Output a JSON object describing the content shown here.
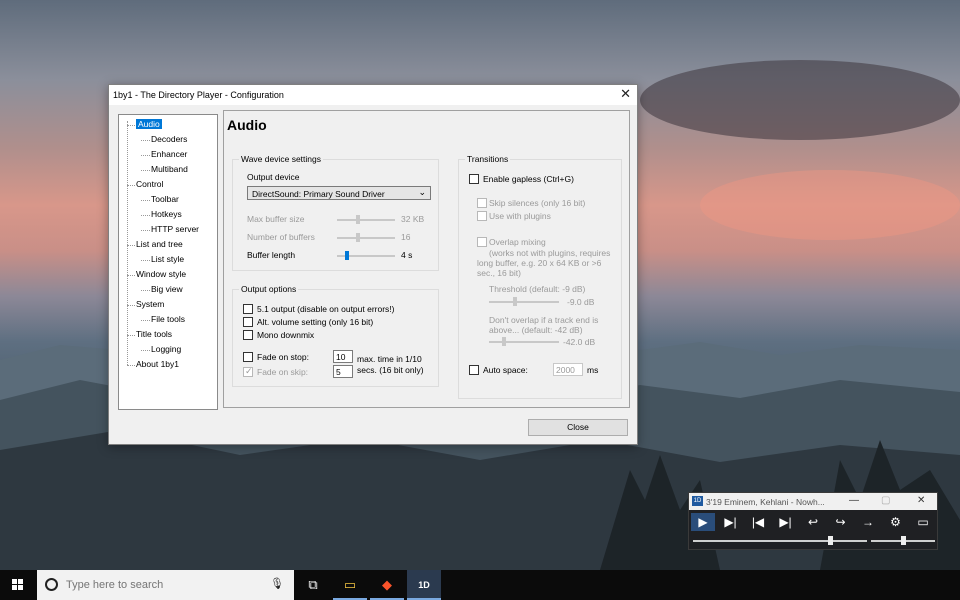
{
  "window": {
    "title": "1by1 - The Directory Player - Configuration",
    "close_glyph": "✕"
  },
  "tree": [
    {
      "label": "Audio",
      "indent": 0,
      "selected": true
    },
    {
      "label": "Decoders",
      "indent": 1
    },
    {
      "label": "Enhancer",
      "indent": 1
    },
    {
      "label": "Multiband",
      "indent": 1
    },
    {
      "label": "Control",
      "indent": 0
    },
    {
      "label": "Toolbar",
      "indent": 1
    },
    {
      "label": "Hotkeys",
      "indent": 1
    },
    {
      "label": "HTTP server",
      "indent": 1
    },
    {
      "label": "List and tree",
      "indent": 0
    },
    {
      "label": "List style",
      "indent": 1
    },
    {
      "label": "Window style",
      "indent": 0
    },
    {
      "label": "Big view",
      "indent": 1
    },
    {
      "label": "System",
      "indent": 0
    },
    {
      "label": "File tools",
      "indent": 1
    },
    {
      "label": "Title tools",
      "indent": 0
    },
    {
      "label": "Logging",
      "indent": 1
    },
    {
      "label": "About 1by1",
      "indent": 0
    }
  ],
  "panel": {
    "title": "Audio",
    "wave": {
      "group": "Wave device settings",
      "output_device_label": "Output device",
      "output_device_value": "DirectSound: Primary Sound Driver",
      "max_buffer_label": "Max buffer size",
      "max_buffer_value": "32 KB",
      "num_buffers_label": "Number of buffers",
      "num_buffers_value": "16",
      "buffer_length_label": "Buffer length",
      "buffer_length_value": "4 s"
    },
    "output": {
      "group": "Output options",
      "opt_51": "5.1 output (disable on output errors!)",
      "opt_alt": "Alt. volume setting (only 16 bit)",
      "opt_mono": "Mono downmix",
      "fade_stop": "Fade on stop:",
      "fade_stop_value": "10",
      "fade_skip": "Fade on skip:",
      "fade_skip_value": "5",
      "fade_note_1": "max. time in 1/10",
      "fade_note_2": "secs. (16 bit only)"
    },
    "transitions": {
      "group": "Transitions",
      "gapless": "Enable gapless (Ctrl+G)",
      "skip_silences": "Skip silences (only 16 bit)",
      "use_plugins": "Use with plugins",
      "overlap": "Overlap mixing",
      "overlap_note_1": "(works not with plugins, requires",
      "overlap_note_2": "long buffer, e.g. 20 x 64 KB or >6",
      "overlap_note_3": "sec., 16 bit)",
      "threshold_label": "Threshold (default: -9 dB)",
      "threshold_value": "-9.0 dB",
      "no_overlap_1": "Don't overlap if a track end is",
      "no_overlap_2": "above... (default: -42 dB)",
      "no_overlap_value": "-42.0 dB",
      "auto_space": "Auto space:",
      "auto_space_value": "2000",
      "auto_space_unit": "ms"
    },
    "close_label": "Close"
  },
  "mini_player": {
    "title": "3'19 Eminem, Kehlani - Nowh...",
    "app_icon": "1D",
    "buttons": [
      "▶",
      "▶|",
      "|◀",
      "▶|",
      "↩",
      "↪",
      "→",
      "⚙",
      "▭"
    ],
    "position_fraction": 0.79,
    "volume_fraction": 0.5
  },
  "taskbar": {
    "search_placeholder": "Type here to search",
    "apps": [
      {
        "name": "task-view-icon",
        "glyph": "⧉"
      },
      {
        "name": "file-explorer-icon",
        "glyph": "▭"
      },
      {
        "name": "brave-browser-icon",
        "glyph": "◆"
      },
      {
        "name": "1by1-player-icon",
        "glyph": "1D"
      }
    ]
  }
}
